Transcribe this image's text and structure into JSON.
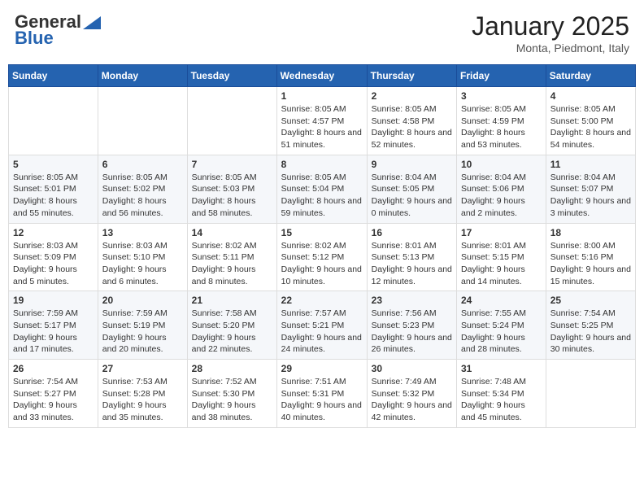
{
  "header": {
    "logo_general": "General",
    "logo_blue": "Blue",
    "month_title": "January 2025",
    "location": "Monta, Piedmont, Italy"
  },
  "weekdays": [
    "Sunday",
    "Monday",
    "Tuesday",
    "Wednesday",
    "Thursday",
    "Friday",
    "Saturday"
  ],
  "weeks": [
    [
      {
        "day": "",
        "content": ""
      },
      {
        "day": "",
        "content": ""
      },
      {
        "day": "",
        "content": ""
      },
      {
        "day": "1",
        "content": "Sunrise: 8:05 AM\nSunset: 4:57 PM\nDaylight: 8 hours and 51 minutes."
      },
      {
        "day": "2",
        "content": "Sunrise: 8:05 AM\nSunset: 4:58 PM\nDaylight: 8 hours and 52 minutes."
      },
      {
        "day": "3",
        "content": "Sunrise: 8:05 AM\nSunset: 4:59 PM\nDaylight: 8 hours and 53 minutes."
      },
      {
        "day": "4",
        "content": "Sunrise: 8:05 AM\nSunset: 5:00 PM\nDaylight: 8 hours and 54 minutes."
      }
    ],
    [
      {
        "day": "5",
        "content": "Sunrise: 8:05 AM\nSunset: 5:01 PM\nDaylight: 8 hours and 55 minutes."
      },
      {
        "day": "6",
        "content": "Sunrise: 8:05 AM\nSunset: 5:02 PM\nDaylight: 8 hours and 56 minutes."
      },
      {
        "day": "7",
        "content": "Sunrise: 8:05 AM\nSunset: 5:03 PM\nDaylight: 8 hours and 58 minutes."
      },
      {
        "day": "8",
        "content": "Sunrise: 8:05 AM\nSunset: 5:04 PM\nDaylight: 8 hours and 59 minutes."
      },
      {
        "day": "9",
        "content": "Sunrise: 8:04 AM\nSunset: 5:05 PM\nDaylight: 9 hours and 0 minutes."
      },
      {
        "day": "10",
        "content": "Sunrise: 8:04 AM\nSunset: 5:06 PM\nDaylight: 9 hours and 2 minutes."
      },
      {
        "day": "11",
        "content": "Sunrise: 8:04 AM\nSunset: 5:07 PM\nDaylight: 9 hours and 3 minutes."
      }
    ],
    [
      {
        "day": "12",
        "content": "Sunrise: 8:03 AM\nSunset: 5:09 PM\nDaylight: 9 hours and 5 minutes."
      },
      {
        "day": "13",
        "content": "Sunrise: 8:03 AM\nSunset: 5:10 PM\nDaylight: 9 hours and 6 minutes."
      },
      {
        "day": "14",
        "content": "Sunrise: 8:02 AM\nSunset: 5:11 PM\nDaylight: 9 hours and 8 minutes."
      },
      {
        "day": "15",
        "content": "Sunrise: 8:02 AM\nSunset: 5:12 PM\nDaylight: 9 hours and 10 minutes."
      },
      {
        "day": "16",
        "content": "Sunrise: 8:01 AM\nSunset: 5:13 PM\nDaylight: 9 hours and 12 minutes."
      },
      {
        "day": "17",
        "content": "Sunrise: 8:01 AM\nSunset: 5:15 PM\nDaylight: 9 hours and 14 minutes."
      },
      {
        "day": "18",
        "content": "Sunrise: 8:00 AM\nSunset: 5:16 PM\nDaylight: 9 hours and 15 minutes."
      }
    ],
    [
      {
        "day": "19",
        "content": "Sunrise: 7:59 AM\nSunset: 5:17 PM\nDaylight: 9 hours and 17 minutes."
      },
      {
        "day": "20",
        "content": "Sunrise: 7:59 AM\nSunset: 5:19 PM\nDaylight: 9 hours and 20 minutes."
      },
      {
        "day": "21",
        "content": "Sunrise: 7:58 AM\nSunset: 5:20 PM\nDaylight: 9 hours and 22 minutes."
      },
      {
        "day": "22",
        "content": "Sunrise: 7:57 AM\nSunset: 5:21 PM\nDaylight: 9 hours and 24 minutes."
      },
      {
        "day": "23",
        "content": "Sunrise: 7:56 AM\nSunset: 5:23 PM\nDaylight: 9 hours and 26 minutes."
      },
      {
        "day": "24",
        "content": "Sunrise: 7:55 AM\nSunset: 5:24 PM\nDaylight: 9 hours and 28 minutes."
      },
      {
        "day": "25",
        "content": "Sunrise: 7:54 AM\nSunset: 5:25 PM\nDaylight: 9 hours and 30 minutes."
      }
    ],
    [
      {
        "day": "26",
        "content": "Sunrise: 7:54 AM\nSunset: 5:27 PM\nDaylight: 9 hours and 33 minutes."
      },
      {
        "day": "27",
        "content": "Sunrise: 7:53 AM\nSunset: 5:28 PM\nDaylight: 9 hours and 35 minutes."
      },
      {
        "day": "28",
        "content": "Sunrise: 7:52 AM\nSunset: 5:30 PM\nDaylight: 9 hours and 38 minutes."
      },
      {
        "day": "29",
        "content": "Sunrise: 7:51 AM\nSunset: 5:31 PM\nDaylight: 9 hours and 40 minutes."
      },
      {
        "day": "30",
        "content": "Sunrise: 7:49 AM\nSunset: 5:32 PM\nDaylight: 9 hours and 42 minutes."
      },
      {
        "day": "31",
        "content": "Sunrise: 7:48 AM\nSunset: 5:34 PM\nDaylight: 9 hours and 45 minutes."
      },
      {
        "day": "",
        "content": ""
      }
    ]
  ]
}
